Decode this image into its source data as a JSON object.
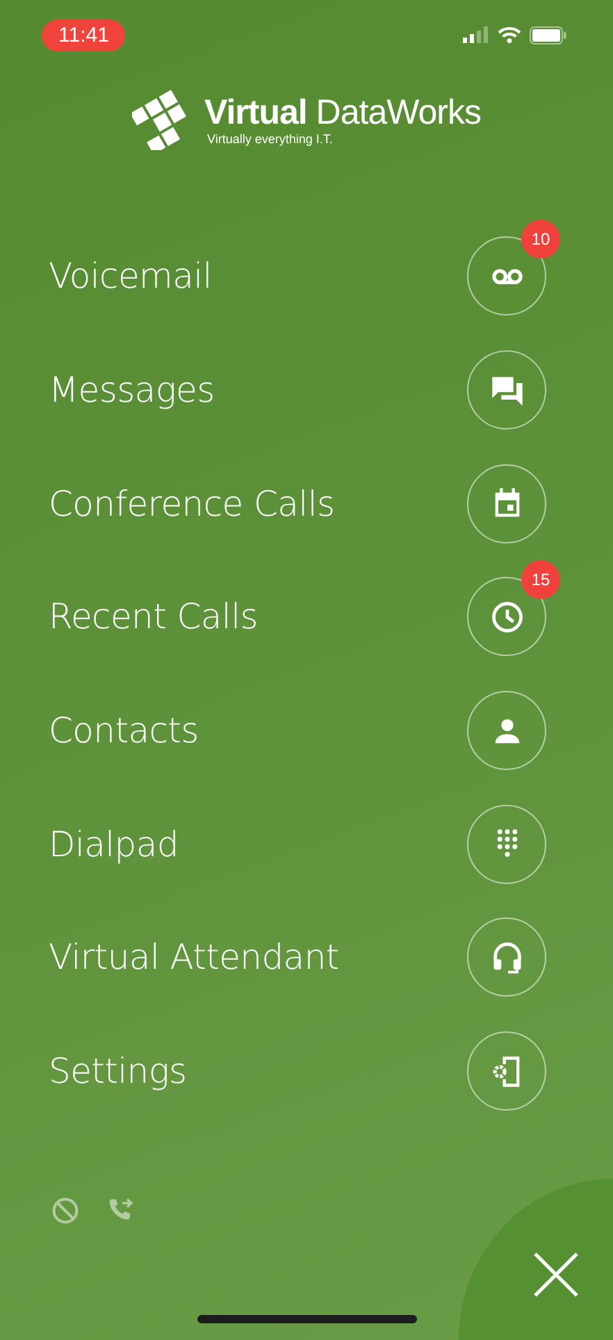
{
  "status_bar": {
    "time": "11:41"
  },
  "logo": {
    "name": "**Virtual** DataWorks",
    "tagline": "Virtually everything I.T."
  },
  "menu": [
    {
      "label": "Voicemail",
      "kind": "voicemail",
      "badge": "10"
    },
    {
      "label": "Messages",
      "kind": "chat"
    },
    {
      "label": "Conference Calls",
      "kind": "calendar"
    },
    {
      "label": "Recent Calls",
      "kind": "clock",
      "badge": "15"
    },
    {
      "label": "Contacts",
      "kind": "person"
    },
    {
      "label": "Dialpad",
      "kind": "dialpad"
    },
    {
      "label": "Virtual Attendant",
      "kind": "headset"
    },
    {
      "label": "Settings",
      "kind": "phone-settings"
    }
  ],
  "footer": {
    "icons": [
      {
        "kind": "block"
      },
      {
        "kind": "call-forward"
      }
    ]
  }
}
